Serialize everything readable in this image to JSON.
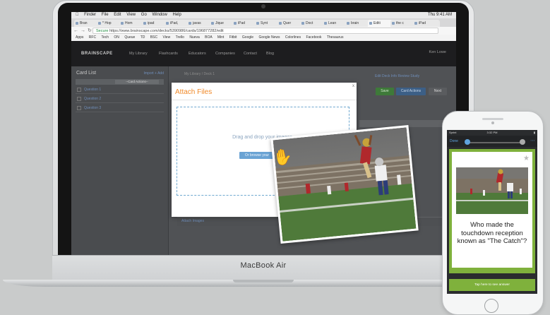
{
  "menubar": {
    "items": [
      "Finder",
      "File",
      "Edit",
      "View",
      "Go",
      "Window",
      "Help"
    ],
    "clock": "Thu 9:41 AM"
  },
  "browser": {
    "tabs": [
      "Bran",
      "* Hop",
      "Hom",
      "ipad",
      "iPad,",
      "javas",
      "Jique",
      "iPad",
      "Synt",
      "Quer",
      "Doct",
      "Lean",
      "brain",
      "Editi",
      "the c",
      "iPad"
    ],
    "url_secure": "Secure",
    "url": "https://www.brainscape.com/decks/5390986/cards/196877282/edit",
    "bookmarks": [
      "Apps",
      "RFC",
      "Tech",
      "ON",
      "Queue",
      "TD",
      "BSC",
      "View",
      "Trello",
      "Nueva",
      "BOA",
      "Mint",
      "Fitbit",
      "Google",
      "Google News",
      "Colorlines",
      "Facebook",
      "Thesaurus"
    ]
  },
  "site": {
    "logo": "BRAINSCAPE",
    "nav": [
      "My Library",
      "Flashcards",
      "Educators",
      "Companies",
      "Contact",
      "Blog"
    ],
    "user": "Ken Lowe"
  },
  "sidebar": {
    "title": "Card List",
    "actions": "Import  + Add",
    "select": "--Card Actions--",
    "rows": [
      "Question 1",
      "Question 2",
      "Question 3"
    ]
  },
  "main": {
    "breadcrumb": "My Library / Deck 1",
    "links": "Edit Deck Info   Review   Study",
    "save": "Save",
    "card_actions": "Card Actions",
    "next": "Next",
    "attach_link": "Attach Images"
  },
  "modal": {
    "title": "Attach Files",
    "close": "x",
    "drop_text": "Drag and drop your images.",
    "browse_btn": "Or browse your"
  },
  "laptop": {
    "brand": "MacBook Air"
  },
  "phone": {
    "carrier": "Sprint",
    "time": "3:32 PM",
    "done": "Done",
    "question": "Who made the touchdown reception known as \"The Catch\"?",
    "tap_button": "Tap here to see answer"
  }
}
